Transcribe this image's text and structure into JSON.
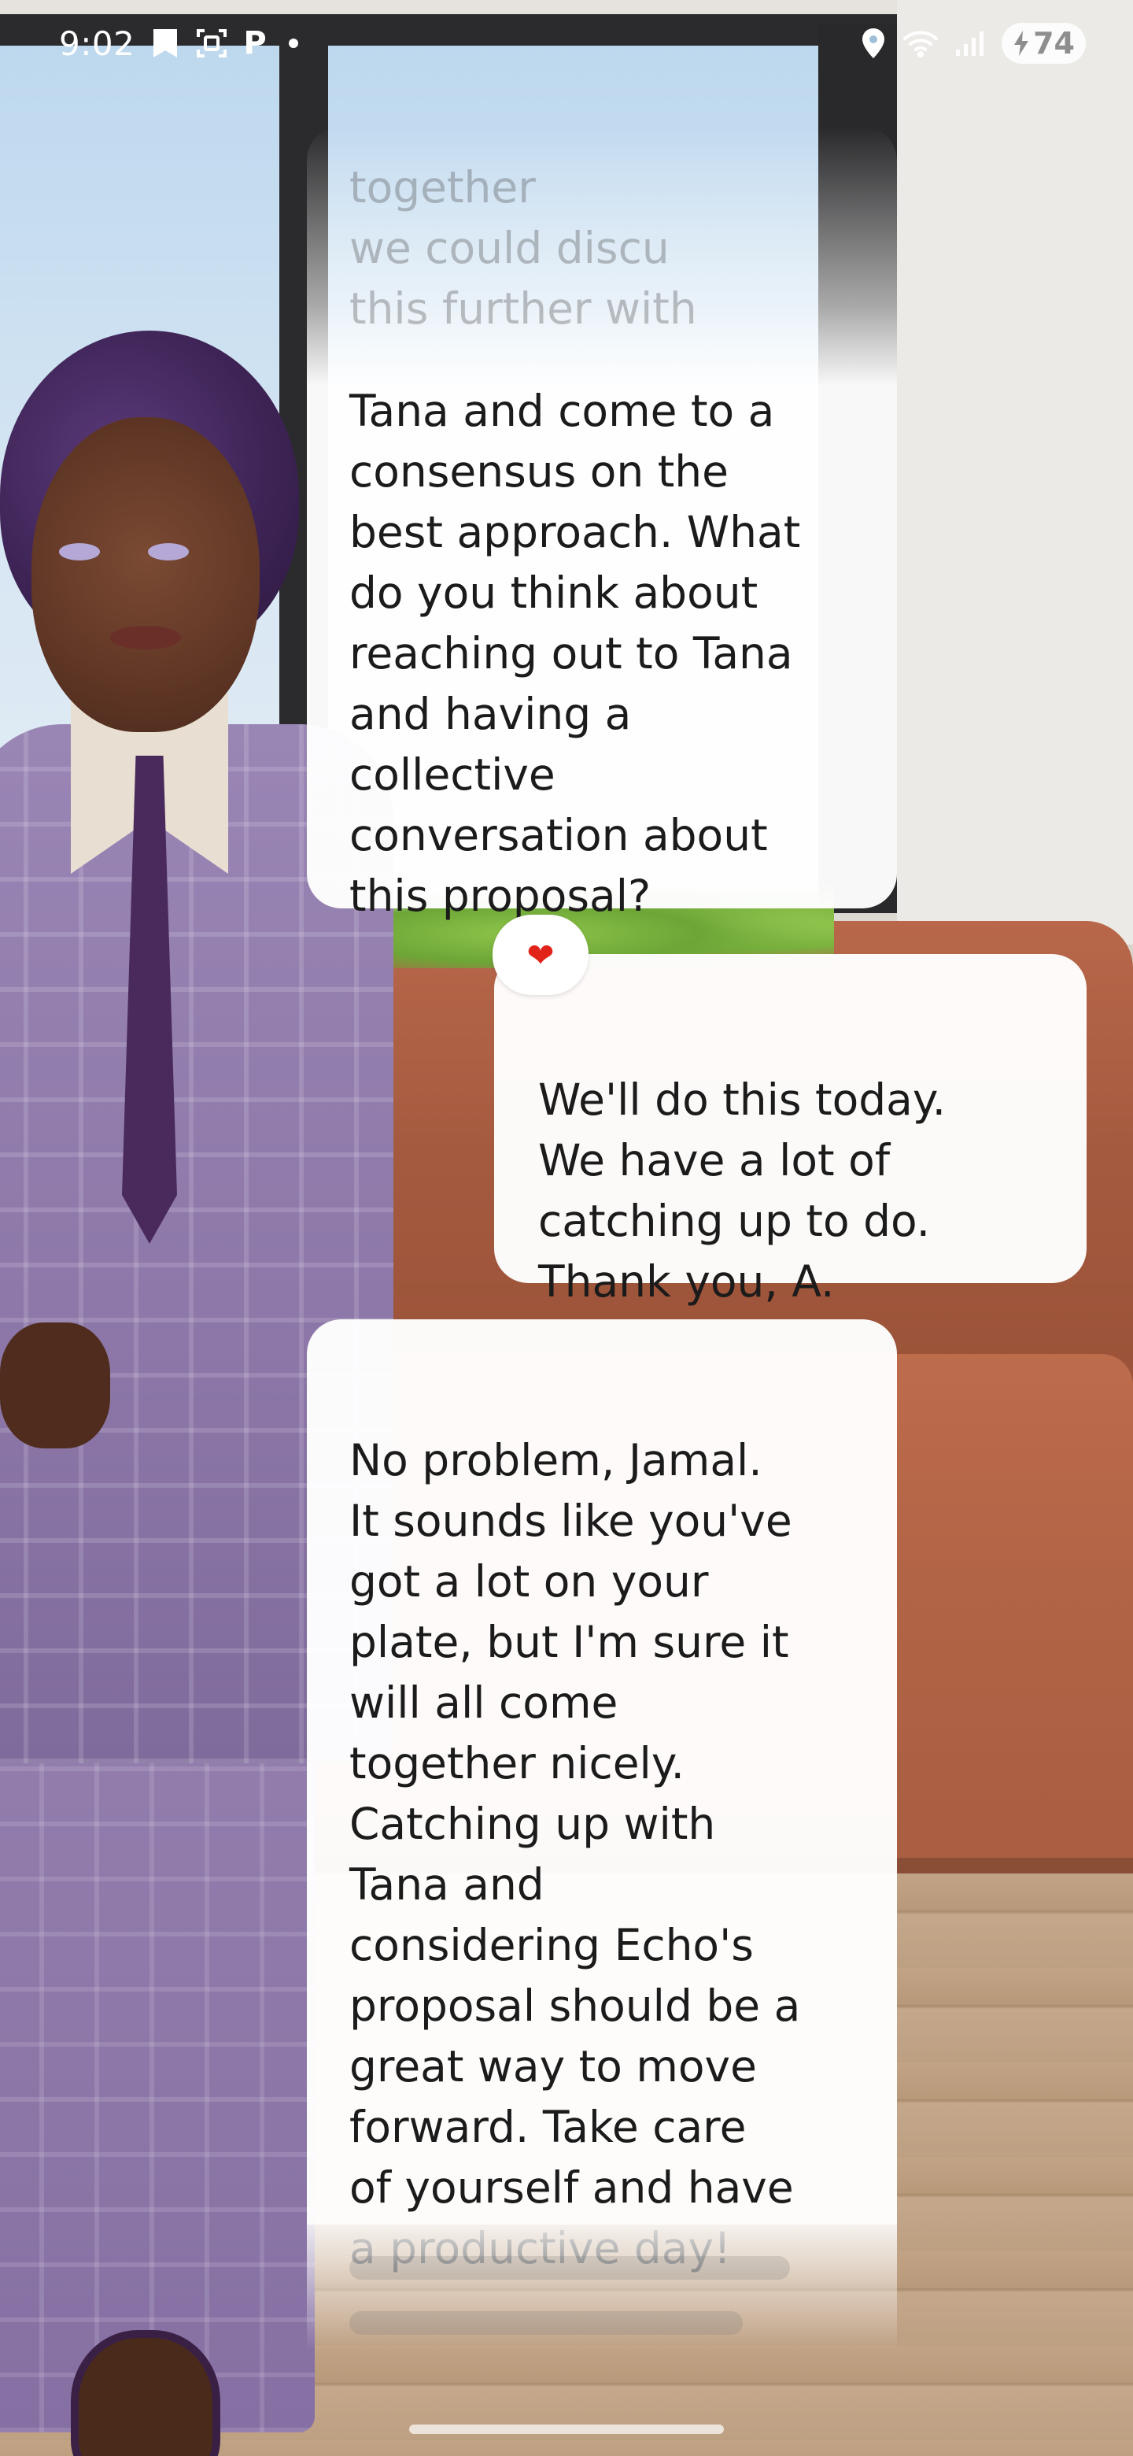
{
  "status_bar": {
    "time": "9:02",
    "battery": "74",
    "left_icons": [
      "bookmark-icon",
      "screen-capture-icon",
      "parking-icon",
      "dot-icon"
    ],
    "right_icons": [
      "location-icon",
      "wifi-icon",
      "signal-icon",
      "battery-icon"
    ],
    "parking_glyph": "P"
  },
  "chat": {
    "messages": [
      {
        "sender": "ai",
        "faded_text": "together\nwe could discu\nthis further with",
        "text": "Tana and come to a\nconsensus on the\nbest approach. What\ndo you think about\nreaching out to Tana\nand having a\ncollective\nconversation about\nthis proposal?"
      },
      {
        "sender": "user",
        "reaction": "❤",
        "text": "We'll do this today.\nWe have a lot of\ncatching up to do.\nThank you, A."
      },
      {
        "sender": "ai",
        "text": "No problem, Jamal.\nIt sounds like you've\ngot a lot on your\nplate, but I'm sure it\nwill all come\ntogether nicely.\nCatching up with\nTana and\nconsidering Echo's\nproposal should be a\ngreat way to move\nforward. Take care\nof yourself and have\na productive day!"
      }
    ]
  },
  "colors": {
    "bubble_bg": "#ffffff",
    "text": "#1b1b1b",
    "reaction_heart": "#e2231a",
    "status_text": "#ffffff"
  }
}
